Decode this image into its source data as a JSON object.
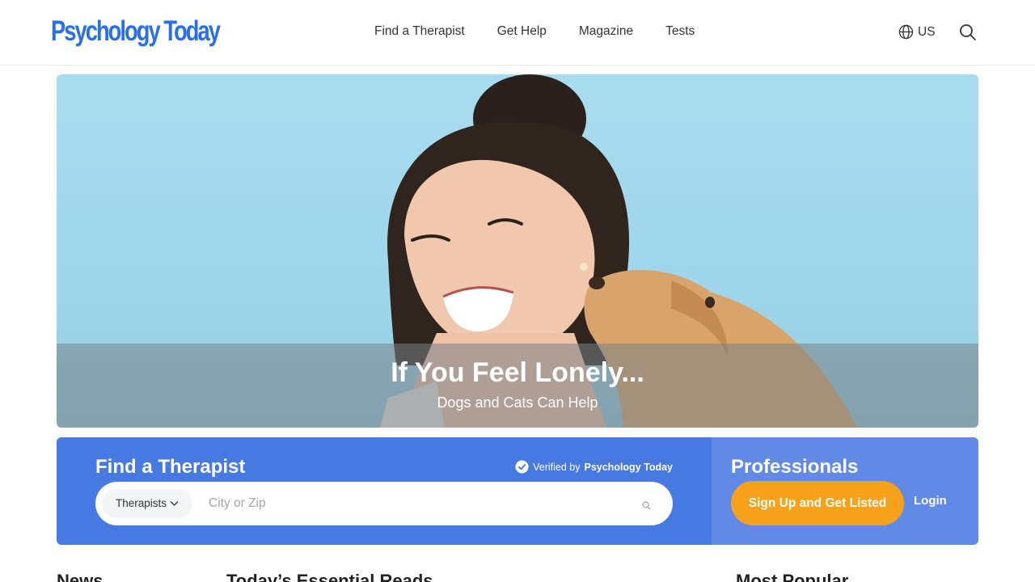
{
  "header": {
    "logo_text": "Psychology Today",
    "nav": [
      "Find a Therapist",
      "Get Help",
      "Magazine",
      "Tests"
    ],
    "region_label": "US",
    "icons": {
      "region": "globe-icon",
      "search": "search-icon"
    }
  },
  "hero": {
    "title": "If You Feel Lonely...",
    "subtitle": "Dogs and Cats Can Help"
  },
  "find_therapist": {
    "title": "Find a Therapist",
    "verified_prefix": "Verified by",
    "verified_brand": "Psychology Today",
    "type_select": "Therapists",
    "location_placeholder": "City or Zip",
    "location_value": ""
  },
  "professionals": {
    "title": "Professionals",
    "signup_label": "Sign Up and Get Listed",
    "login_label": "Login"
  },
  "sections": {
    "news": "News",
    "essential_reads": "Today’s Essential Reads",
    "most_popular": "Most Popular"
  },
  "colors": {
    "brand_blue": "#2970e6",
    "find_band": "#4779e2",
    "pros_band": "#6189e6",
    "signup_orange": "#f7a21a"
  }
}
